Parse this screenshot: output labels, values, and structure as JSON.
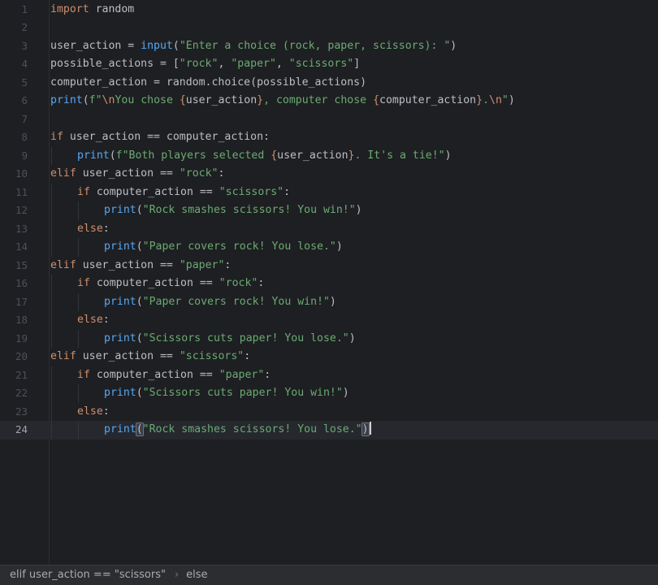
{
  "editor": {
    "language": "python",
    "current_line": 24,
    "lines": [
      {
        "n": "1",
        "indent": 0,
        "tokens": [
          [
            "kw",
            "import"
          ],
          [
            "",
            "&nbsp;random"
          ]
        ]
      },
      {
        "n": "2",
        "indent": 0,
        "tokens": []
      },
      {
        "n": "3",
        "indent": 0,
        "tokens": [
          [
            "",
            "user_action = "
          ],
          [
            "fn",
            "input"
          ],
          [
            "",
            "("
          ],
          [
            "str",
            "\"Enter a choice (rock, paper, scissors): \""
          ],
          [
            "",
            ")"
          ]
        ]
      },
      {
        "n": "4",
        "indent": 0,
        "tokens": [
          [
            "",
            "possible_actions = ["
          ],
          [
            "str",
            "\"rock\""
          ],
          [
            "",
            ", "
          ],
          [
            "str",
            "\"paper\""
          ],
          [
            "",
            ", "
          ],
          [
            "str",
            "\"scissors\""
          ],
          [
            "",
            "]"
          ]
        ]
      },
      {
        "n": "5",
        "indent": 0,
        "tokens": [
          [
            "",
            "computer_action = random.choice(possible_actions)"
          ]
        ]
      },
      {
        "n": "6",
        "indent": 0,
        "tokens": [
          [
            "fn",
            "print"
          ],
          [
            "",
            "("
          ],
          [
            "str",
            "f\""
          ],
          [
            "fs",
            "\\n"
          ],
          [
            "str",
            "You chose "
          ],
          [
            "fs",
            "{"
          ],
          [
            "",
            "user_action"
          ],
          [
            "fs",
            "}"
          ],
          [
            "str",
            ", computer chose "
          ],
          [
            "fs",
            "{"
          ],
          [
            "",
            "computer_action"
          ],
          [
            "fs",
            "}"
          ],
          [
            "str",
            "."
          ],
          [
            "fs",
            "\\n"
          ],
          [
            "str",
            "\""
          ],
          [
            "",
            ")"
          ]
        ]
      },
      {
        "n": "7",
        "indent": 0,
        "tokens": []
      },
      {
        "n": "8",
        "indent": 0,
        "tokens": [
          [
            "kw",
            "if"
          ],
          [
            "",
            " user_action == computer_action:"
          ]
        ]
      },
      {
        "n": "9",
        "indent": 1,
        "tokens": [
          [
            "fn",
            "print"
          ],
          [
            "",
            "("
          ],
          [
            "str",
            "f\"Both players selected "
          ],
          [
            "fs",
            "{"
          ],
          [
            "",
            "user_action"
          ],
          [
            "fs",
            "}"
          ],
          [
            "str",
            ". It's a tie!\""
          ],
          [
            "",
            ")"
          ]
        ]
      },
      {
        "n": "10",
        "indent": 0,
        "tokens": [
          [
            "kw",
            "elif"
          ],
          [
            "",
            " user_action == "
          ],
          [
            "str",
            "\"rock\""
          ],
          [
            "",
            ":"
          ]
        ]
      },
      {
        "n": "11",
        "indent": 1,
        "tokens": [
          [
            "kw",
            "if"
          ],
          [
            "",
            " computer_action == "
          ],
          [
            "str",
            "\"scissors\""
          ],
          [
            "",
            ":"
          ]
        ]
      },
      {
        "n": "12",
        "indent": 2,
        "tokens": [
          [
            "fn",
            "print"
          ],
          [
            "",
            "("
          ],
          [
            "str",
            "\"Rock smashes scissors! You win!\""
          ],
          [
            "",
            ")"
          ]
        ]
      },
      {
        "n": "13",
        "indent": 1,
        "tokens": [
          [
            "kw",
            "else"
          ],
          [
            "",
            ":"
          ]
        ]
      },
      {
        "n": "14",
        "indent": 2,
        "tokens": [
          [
            "fn",
            "print"
          ],
          [
            "",
            "("
          ],
          [
            "str",
            "\"Paper covers rock! You lose.\""
          ],
          [
            "",
            ")"
          ]
        ]
      },
      {
        "n": "15",
        "indent": 0,
        "tokens": [
          [
            "kw",
            "elif"
          ],
          [
            "",
            " user_action == "
          ],
          [
            "str",
            "\"paper\""
          ],
          [
            "",
            ":"
          ]
        ]
      },
      {
        "n": "16",
        "indent": 1,
        "tokens": [
          [
            "kw",
            "if"
          ],
          [
            "",
            " computer_action == "
          ],
          [
            "str",
            "\"rock\""
          ],
          [
            "",
            ":"
          ]
        ]
      },
      {
        "n": "17",
        "indent": 2,
        "tokens": [
          [
            "fn",
            "print"
          ],
          [
            "",
            "("
          ],
          [
            "str",
            "\"Paper covers rock! You win!\""
          ],
          [
            "",
            ")"
          ]
        ]
      },
      {
        "n": "18",
        "indent": 1,
        "tokens": [
          [
            "kw",
            "else"
          ],
          [
            "",
            ":"
          ]
        ]
      },
      {
        "n": "19",
        "indent": 2,
        "tokens": [
          [
            "fn",
            "print"
          ],
          [
            "",
            "("
          ],
          [
            "str",
            "\"Scissors cuts paper! You lose.\""
          ],
          [
            "",
            ")"
          ]
        ]
      },
      {
        "n": "20",
        "indent": 0,
        "tokens": [
          [
            "kw",
            "elif"
          ],
          [
            "",
            " user_action == "
          ],
          [
            "str",
            "\"scissors\""
          ],
          [
            "",
            ":"
          ]
        ]
      },
      {
        "n": "21",
        "indent": 1,
        "tokens": [
          [
            "kw",
            "if"
          ],
          [
            "",
            " computer_action == "
          ],
          [
            "str",
            "\"paper\""
          ],
          [
            "",
            ":"
          ]
        ]
      },
      {
        "n": "22",
        "indent": 2,
        "tokens": [
          [
            "fn",
            "print"
          ],
          [
            "",
            "("
          ],
          [
            "str",
            "\"Scissors cuts paper! You win!\""
          ],
          [
            "",
            ")"
          ]
        ]
      },
      {
        "n": "23",
        "indent": 1,
        "tokens": [
          [
            "kw",
            "else"
          ],
          [
            "",
            ":"
          ]
        ]
      },
      {
        "n": "24",
        "indent": 2,
        "tokens": [
          [
            "fn",
            "print"
          ],
          [
            "match",
            "("
          ],
          [
            "str",
            "\"Rock smashes scissors! You lose.\""
          ],
          [
            "match",
            ")"
          ],
          [
            "caret",
            ""
          ]
        ]
      }
    ]
  },
  "status_bar": {
    "breadcrumbs": [
      "elif user_action == \"scissors\"",
      "else"
    ],
    "separator_icon": "chevron-right-icon"
  },
  "colors": {
    "background": "#1e1f22",
    "keyword": "#cf8e6d",
    "string": "#6aab73",
    "function": "#56a8f5",
    "text": "#bcbec4",
    "line_number": "#4b5059",
    "current_line_bg": "#26282e"
  }
}
